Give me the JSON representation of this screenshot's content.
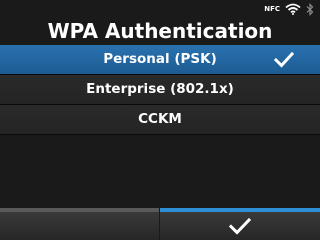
{
  "status": {
    "nfc_label": "NFC",
    "icons": [
      "nfc-icon",
      "wifi-icon",
      "bluetooth-icon"
    ]
  },
  "title": "WPA Authentication",
  "options": [
    {
      "label": "Personal (PSK)",
      "selected": true
    },
    {
      "label": "Enterprise (802.1x)",
      "selected": false
    },
    {
      "label": "CCKM",
      "selected": false
    }
  ],
  "colors": {
    "selected_row": "#2a72b0",
    "accent_bar": "#2d8fd6",
    "background": "#1a1a1a"
  },
  "bottom_buttons": {
    "left": {
      "icon": "none"
    },
    "right": {
      "icon": "checkmark-icon"
    }
  }
}
